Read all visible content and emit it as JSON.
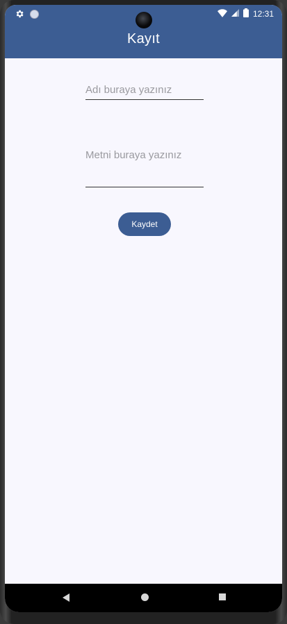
{
  "status_bar": {
    "time": "12:31",
    "left_icons": [
      "settings-icon",
      "circle-icon"
    ],
    "right_icons": [
      "wifi-icon",
      "signal-icon",
      "battery-icon"
    ]
  },
  "app_bar": {
    "title": "Kayıt",
    "color": "#3c5d93"
  },
  "form": {
    "name_field": {
      "placeholder": "Adı buraya yazınız",
      "value": ""
    },
    "text_field": {
      "placeholder": "Metni buraya yazınız",
      "value": ""
    },
    "save_button_label": "Kaydet"
  },
  "nav_bar": {
    "icons": [
      "back-icon",
      "home-icon",
      "recents-icon"
    ]
  }
}
